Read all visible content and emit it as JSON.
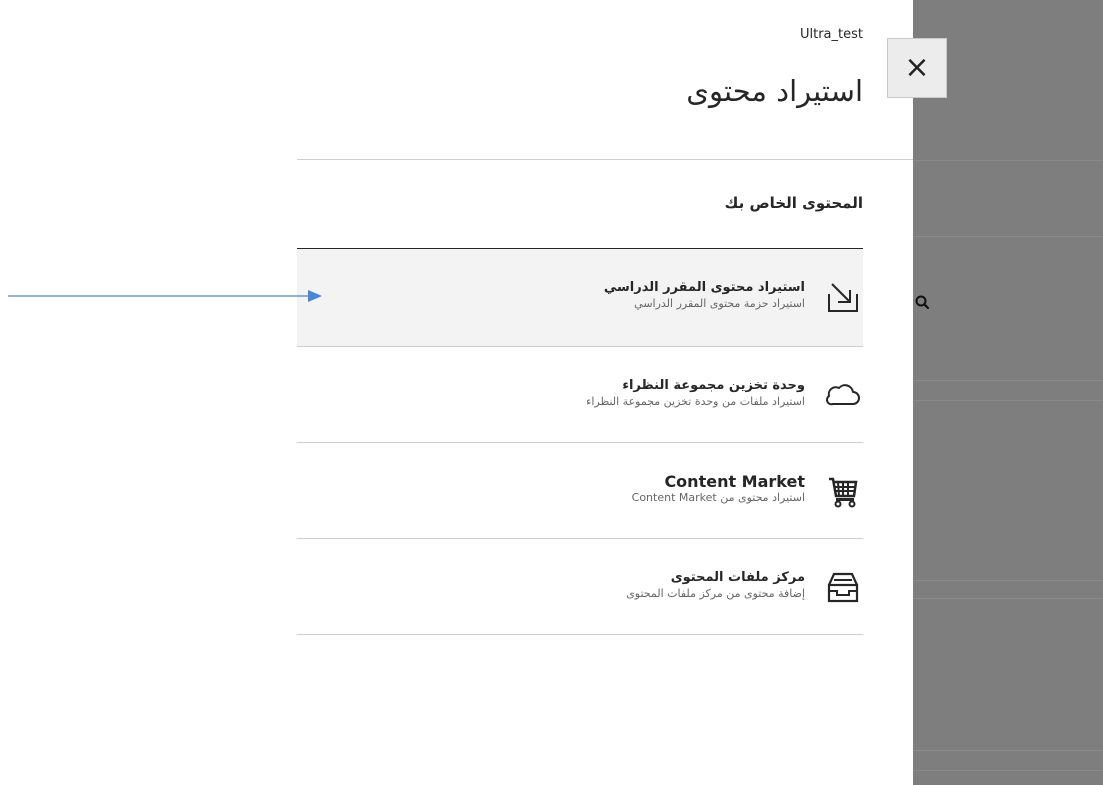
{
  "panel": {
    "course_name": "Ultra_test",
    "title": "استيراد محتوى",
    "close_label": "×",
    "section_heading": "المحتوى الخاص بك"
  },
  "items": [
    {
      "title": "استيراد محتوى المقرر الدراسي",
      "subtitle": "استيراد حزمة محتوى المقرر الدراسي",
      "icon": "import-arrow-icon"
    },
    {
      "title": "وحدة تخزين مجموعة النظراء",
      "subtitle": "استيراد ملفات من وحدة تخزين مجموعة النظراء",
      "icon": "cloud-icon"
    },
    {
      "title": "Content Market",
      "subtitle": "استيراد محتوى من Content Market",
      "icon": "cart-icon"
    },
    {
      "title": "مركز ملفات المحتوى",
      "subtitle": "إضافة محتوى من مركز ملفات المحتوى",
      "icon": "inbox-tray-icon"
    }
  ],
  "annotation": {
    "arrow_color": "#4a86d8"
  },
  "colors": {
    "backdrop": "#7b7b7b",
    "text": "#262626",
    "highlight_row": "#f3f3f3"
  }
}
